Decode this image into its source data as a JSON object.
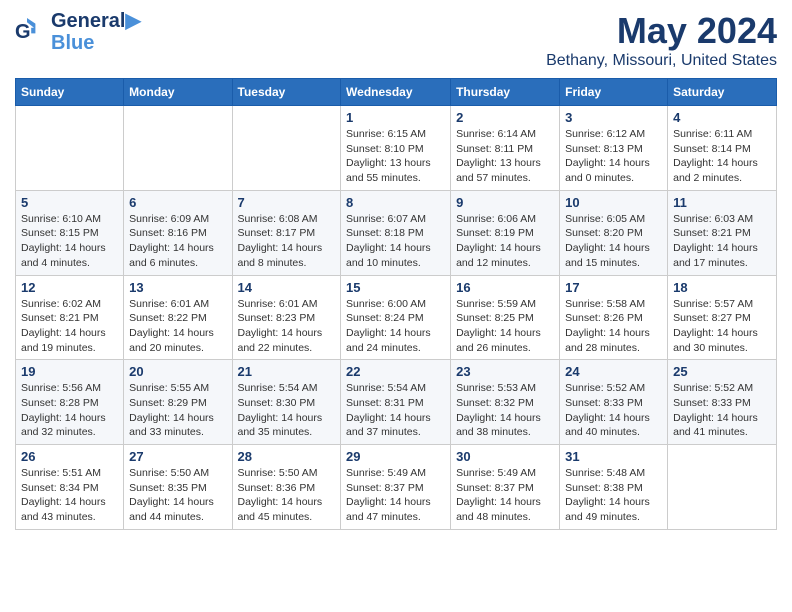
{
  "header": {
    "logo_line1": "General",
    "logo_line2": "Blue",
    "title": "May 2024",
    "subtitle": "Bethany, Missouri, United States"
  },
  "days_of_week": [
    "Sunday",
    "Monday",
    "Tuesday",
    "Wednesday",
    "Thursday",
    "Friday",
    "Saturday"
  ],
  "weeks": [
    [
      {
        "day": "",
        "info": ""
      },
      {
        "day": "",
        "info": ""
      },
      {
        "day": "",
        "info": ""
      },
      {
        "day": "1",
        "info": "Sunrise: 6:15 AM\nSunset: 8:10 PM\nDaylight: 13 hours\nand 55 minutes."
      },
      {
        "day": "2",
        "info": "Sunrise: 6:14 AM\nSunset: 8:11 PM\nDaylight: 13 hours\nand 57 minutes."
      },
      {
        "day": "3",
        "info": "Sunrise: 6:12 AM\nSunset: 8:13 PM\nDaylight: 14 hours\nand 0 minutes."
      },
      {
        "day": "4",
        "info": "Sunrise: 6:11 AM\nSunset: 8:14 PM\nDaylight: 14 hours\nand 2 minutes."
      }
    ],
    [
      {
        "day": "5",
        "info": "Sunrise: 6:10 AM\nSunset: 8:15 PM\nDaylight: 14 hours\nand 4 minutes."
      },
      {
        "day": "6",
        "info": "Sunrise: 6:09 AM\nSunset: 8:16 PM\nDaylight: 14 hours\nand 6 minutes."
      },
      {
        "day": "7",
        "info": "Sunrise: 6:08 AM\nSunset: 8:17 PM\nDaylight: 14 hours\nand 8 minutes."
      },
      {
        "day": "8",
        "info": "Sunrise: 6:07 AM\nSunset: 8:18 PM\nDaylight: 14 hours\nand 10 minutes."
      },
      {
        "day": "9",
        "info": "Sunrise: 6:06 AM\nSunset: 8:19 PM\nDaylight: 14 hours\nand 12 minutes."
      },
      {
        "day": "10",
        "info": "Sunrise: 6:05 AM\nSunset: 8:20 PM\nDaylight: 14 hours\nand 15 minutes."
      },
      {
        "day": "11",
        "info": "Sunrise: 6:03 AM\nSunset: 8:21 PM\nDaylight: 14 hours\nand 17 minutes."
      }
    ],
    [
      {
        "day": "12",
        "info": "Sunrise: 6:02 AM\nSunset: 8:21 PM\nDaylight: 14 hours\nand 19 minutes."
      },
      {
        "day": "13",
        "info": "Sunrise: 6:01 AM\nSunset: 8:22 PM\nDaylight: 14 hours\nand 20 minutes."
      },
      {
        "day": "14",
        "info": "Sunrise: 6:01 AM\nSunset: 8:23 PM\nDaylight: 14 hours\nand 22 minutes."
      },
      {
        "day": "15",
        "info": "Sunrise: 6:00 AM\nSunset: 8:24 PM\nDaylight: 14 hours\nand 24 minutes."
      },
      {
        "day": "16",
        "info": "Sunrise: 5:59 AM\nSunset: 8:25 PM\nDaylight: 14 hours\nand 26 minutes."
      },
      {
        "day": "17",
        "info": "Sunrise: 5:58 AM\nSunset: 8:26 PM\nDaylight: 14 hours\nand 28 minutes."
      },
      {
        "day": "18",
        "info": "Sunrise: 5:57 AM\nSunset: 8:27 PM\nDaylight: 14 hours\nand 30 minutes."
      }
    ],
    [
      {
        "day": "19",
        "info": "Sunrise: 5:56 AM\nSunset: 8:28 PM\nDaylight: 14 hours\nand 32 minutes."
      },
      {
        "day": "20",
        "info": "Sunrise: 5:55 AM\nSunset: 8:29 PM\nDaylight: 14 hours\nand 33 minutes."
      },
      {
        "day": "21",
        "info": "Sunrise: 5:54 AM\nSunset: 8:30 PM\nDaylight: 14 hours\nand 35 minutes."
      },
      {
        "day": "22",
        "info": "Sunrise: 5:54 AM\nSunset: 8:31 PM\nDaylight: 14 hours\nand 37 minutes."
      },
      {
        "day": "23",
        "info": "Sunrise: 5:53 AM\nSunset: 8:32 PM\nDaylight: 14 hours\nand 38 minutes."
      },
      {
        "day": "24",
        "info": "Sunrise: 5:52 AM\nSunset: 8:33 PM\nDaylight: 14 hours\nand 40 minutes."
      },
      {
        "day": "25",
        "info": "Sunrise: 5:52 AM\nSunset: 8:33 PM\nDaylight: 14 hours\nand 41 minutes."
      }
    ],
    [
      {
        "day": "26",
        "info": "Sunrise: 5:51 AM\nSunset: 8:34 PM\nDaylight: 14 hours\nand 43 minutes."
      },
      {
        "day": "27",
        "info": "Sunrise: 5:50 AM\nSunset: 8:35 PM\nDaylight: 14 hours\nand 44 minutes."
      },
      {
        "day": "28",
        "info": "Sunrise: 5:50 AM\nSunset: 8:36 PM\nDaylight: 14 hours\nand 45 minutes."
      },
      {
        "day": "29",
        "info": "Sunrise: 5:49 AM\nSunset: 8:37 PM\nDaylight: 14 hours\nand 47 minutes."
      },
      {
        "day": "30",
        "info": "Sunrise: 5:49 AM\nSunset: 8:37 PM\nDaylight: 14 hours\nand 48 minutes."
      },
      {
        "day": "31",
        "info": "Sunrise: 5:48 AM\nSunset: 8:38 PM\nDaylight: 14 hours\nand 49 minutes."
      },
      {
        "day": "",
        "info": ""
      }
    ]
  ]
}
